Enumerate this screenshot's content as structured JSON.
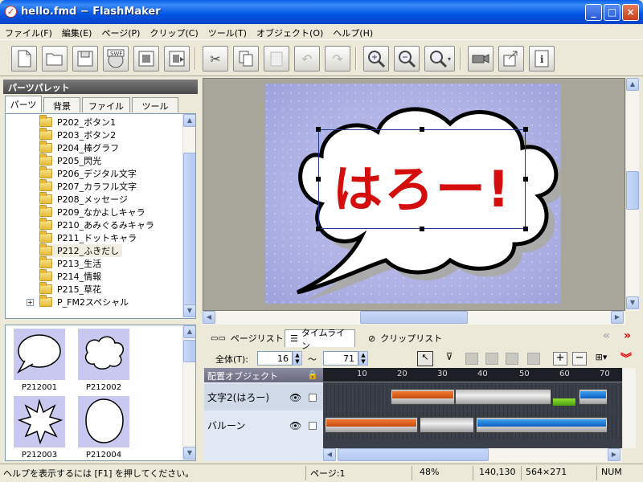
{
  "window": {
    "title": "hello.fmd − FlashMaker"
  },
  "menu": [
    "ファイル(F)",
    "編集(E)",
    "ページ(P)",
    "クリップ(C)",
    "ツール(T)",
    "オブジェクト(O)",
    "ヘルプ(H)"
  ],
  "toolbar": {
    "swf_label": "SWF",
    "info_label": "i"
  },
  "palette": {
    "title": "パーツパレット",
    "tabs": [
      "パーツ",
      "背景",
      "ファイル",
      "ツール"
    ],
    "tree": [
      "P202_ボタン1",
      "P203_ボタン2",
      "P204_棒グラフ",
      "P205_閃光",
      "P206_デジタル文字",
      "P207_カラフル文字",
      "P208_メッセージ",
      "P209_なかよしキャラ",
      "P210_あみぐるみキャラ",
      "P211_ドットキャラ",
      "P212_ふきだし",
      "P213_生活",
      "P214_情報",
      "P215_草花",
      "P_FM2スペシャル"
    ],
    "expand_label": "+",
    "thumbs": [
      "P212001",
      "P212002",
      "P212003",
      "P212004"
    ]
  },
  "canvas": {
    "text": "はろー!"
  },
  "bottom": {
    "tabs": [
      "ページリスト",
      "タイムライン",
      "クリップリスト"
    ],
    "total_label": "全体(T):",
    "start_value": "16",
    "tilde": "〜",
    "end_value": "71",
    "objects_header": "配置オブジェクト",
    "objects": [
      "文字2(はろー)",
      "バルーン"
    ],
    "ruler": [
      "10",
      "20",
      "30",
      "40",
      "50",
      "60",
      "70"
    ]
  },
  "status": {
    "help": "ヘルプを表示するには [F1] を押してください。",
    "page": "ページ:1",
    "zoom": "48%",
    "coords": "140,130",
    "size": "564×271",
    "num": "NUM"
  }
}
